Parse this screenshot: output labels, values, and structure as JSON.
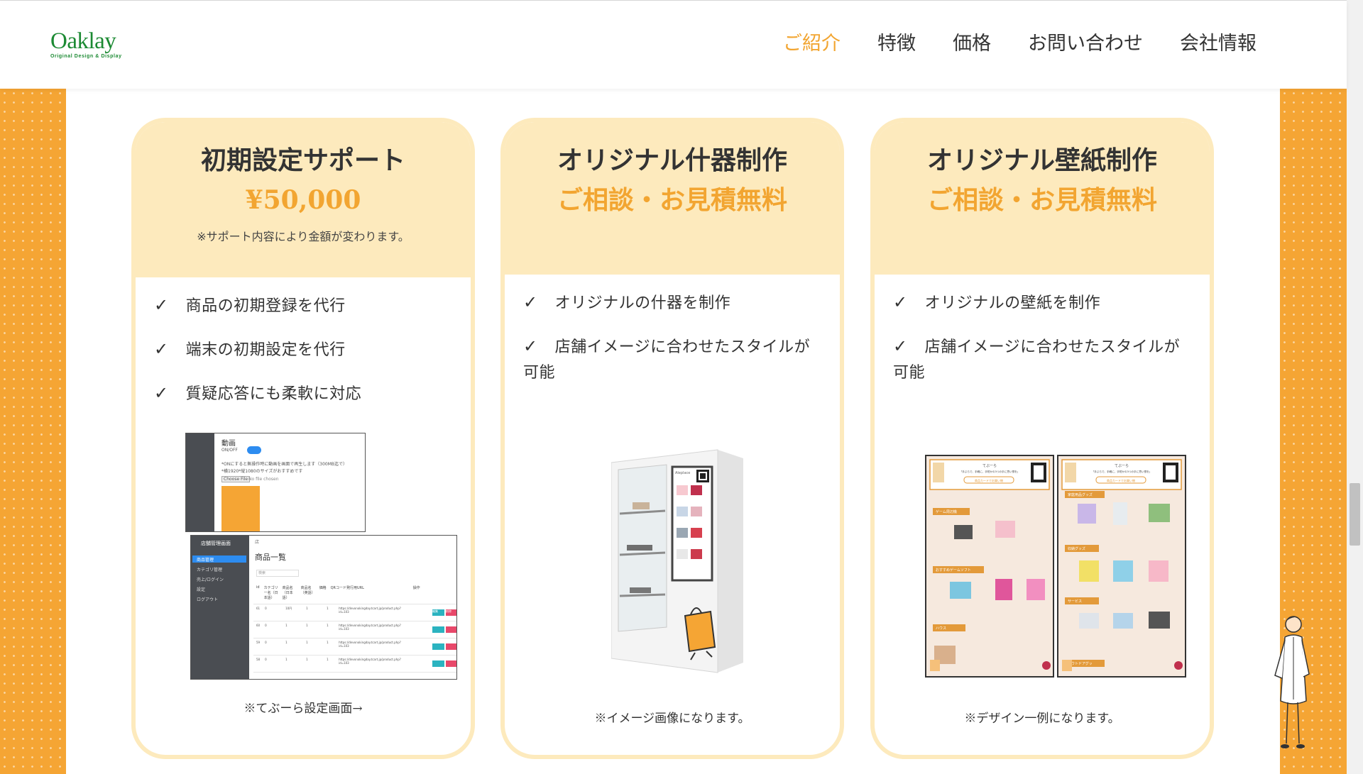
{
  "header": {
    "logo_text": "Oaklay",
    "logo_tagline": "Original Design & Display",
    "nav": [
      {
        "label": "ご紹介",
        "active": true
      },
      {
        "label": "特徴",
        "active": false
      },
      {
        "label": "価格",
        "active": false
      },
      {
        "label": "お問い合わせ",
        "active": false
      },
      {
        "label": "会社情報",
        "active": false
      }
    ]
  },
  "colors": {
    "accent_orange": "#f2a531",
    "card_cream": "#fdeabd",
    "brand_green": "#1c8a33",
    "side_strip": "#f5a534"
  },
  "cards": [
    {
      "title": "初期設定サポート",
      "price": "¥50,000",
      "note": "※サポート内容により金額が変わります。",
      "features": [
        "商品の初期登録を代行",
        "端末の初期設定を代行",
        "質疑応答にも柔軟に対応"
      ],
      "caption": "※てぶーら設定画面→",
      "mock": {
        "back_title": "動画",
        "back_line1": "ON/OFF",
        "back_line2": "*ONにすると無操作時に動画を画面で再生します（300MB迄で）",
        "back_line3": "*横1920*縦1080のサイズがおすすめです",
        "back_file_button": "Choose File",
        "back_file_status": "No file chosen",
        "front_sidebar_title": "店舗管理画面",
        "front_sidebar_items": [
          "商品管理",
          "カテゴリ管理",
          "売上/ログイン",
          "設定",
          "ログアウト"
        ],
        "front_breadcrumb": "店",
        "front_heading": "商品一覧",
        "front_search": "検索",
        "front_columns": [
          "id",
          "カテゴリー名（日本語）",
          "商品名（日本語）",
          "商品名（英語）",
          "価格",
          "QRコード発行用URL",
          "操作"
        ],
        "front_rows": [
          {
            "id": "61",
            "cat": "0",
            "name": "10円",
            "en": "1",
            "price": "1",
            "url": "https://devonokingday.tcart.jp/product.php?id=103"
          },
          {
            "id": "60",
            "cat": "0",
            "name": "1",
            "en": "1",
            "price": "1",
            "url": "https://devonokingday.tcart.jp/product.php?id=103"
          },
          {
            "id": "59",
            "cat": "0",
            "name": "1",
            "en": "1",
            "price": "1",
            "url": "https://devonokingday.tcart.jp/product.php?id=103"
          },
          {
            "id": "58",
            "cat": "0",
            "name": "1",
            "en": "1",
            "price": "1",
            "url": "https://devonokingday.tcart.jp/product.php?id=103"
          }
        ],
        "front_edit_label": "編集",
        "front_delete_label": "削除"
      }
    },
    {
      "title": "オリジナル什器制作",
      "price": "ご相談・お見積無料",
      "features": [
        "オリジナルの什器を制作",
        "店舗イメージに合わせたスタイルが可能"
      ],
      "caption": "※イメージ画像になります。",
      "screen_brand": "Aleplace"
    },
    {
      "title": "オリジナル壁紙制作",
      "price": "ご相談・お見積無料",
      "features": [
        "オリジナルの壁紙を制作",
        "店舗イメージに合わせたスタイルが可能"
      ],
      "caption": "※デザイン一例になります。",
      "wallpaper": {
        "panel1_top": "てぶーら",
        "panel1_sub": "「手ぶらで、手軽に、手短かの3つの手に思い想を」",
        "panel1_button": "商品カードでお買い物",
        "panel1_sections": [
          "ゲーム周辺機",
          "おすすめゲームソフト",
          "ハウス"
        ],
        "panel2_top": "てぶーら",
        "panel2_sub": "「手ぶらで、手軽に、手短かの3つの手に思い想を」",
        "panel2_button": "商品カードでお買い物",
        "panel2_sections": [
          "家庭用品グッズ",
          "収納グッズ",
          "サービス",
          "アウトドアグッ"
        ]
      }
    }
  ],
  "check_mark": "✓"
}
